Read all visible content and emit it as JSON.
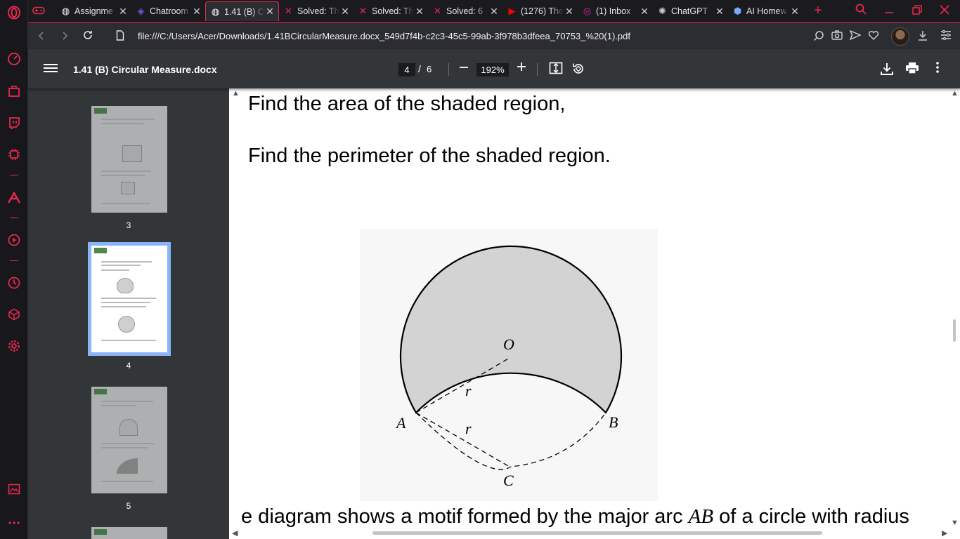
{
  "tabs": [
    {
      "title": "Assignme",
      "favicon": "globe-icon",
      "color": "#ffffff",
      "active": false
    },
    {
      "title": "Chatroom",
      "favicon": "chatroom-icon",
      "color": "#6e5bd8",
      "active": false
    },
    {
      "title": "1.41 (B) C",
      "favicon": "globe-icon",
      "color": "#ffffff",
      "active": true
    },
    {
      "title": "Solved: Th",
      "favicon": "chegg-icon",
      "color": "#e8294d",
      "active": false
    },
    {
      "title": "Solved: Th",
      "favicon": "chegg-icon",
      "color": "#e8294d",
      "active": false
    },
    {
      "title": "Solved: 6",
      "favicon": "chegg-icon",
      "color": "#e8294d",
      "active": false
    },
    {
      "title": "(1276) The",
      "favicon": "youtube-icon",
      "color": "#ff0000",
      "active": false
    },
    {
      "title": "(1) Inbox",
      "favicon": "instagram-icon",
      "color": "#d6249f",
      "active": false
    },
    {
      "title": "ChatGPT",
      "favicon": "chatgpt-icon",
      "color": "#cfcfcf",
      "active": false
    },
    {
      "title": "AI Homew",
      "favicon": "cube-icon",
      "color": "#7da7ff",
      "active": false
    }
  ],
  "address_bar": {
    "url": "file:///C:/Users/Acer/Downloads/1.41BCircularMeasure.docx_549d7f4b-c2c3-45c5-99ab-3f978b3dfeea_70753_%20(1).pdf"
  },
  "pdf_toolbar": {
    "title": "1.41 (B) Circular Measure.docx",
    "current_page": "4",
    "page_separator": "/",
    "total_pages": "6",
    "zoom": "192%"
  },
  "thumbnails": [
    {
      "page": "3",
      "selected": false
    },
    {
      "page": "4",
      "selected": true
    },
    {
      "page": "5",
      "selected": false
    }
  ],
  "document": {
    "line_area": "Find the area of the shaded region,",
    "line_perimeter": "Find the perimeter of the shaded region.",
    "motif_start": "e diagram shows a motif formed by the major arc ",
    "motif_arc": "AB",
    "motif_end": " of a circle with radius",
    "figure_labels": {
      "O": "O",
      "A": "A",
      "B": "B",
      "C": "C",
      "r1": "r",
      "r2": "r"
    }
  },
  "colors": {
    "accent": "#e8294d",
    "toolbar": "#323639",
    "shaded": "#d3d3d3"
  }
}
